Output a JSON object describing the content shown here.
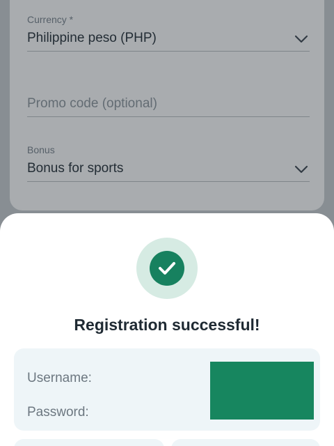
{
  "form": {
    "currency": {
      "label": "Currency *",
      "value": "Philippine peso (PHP)"
    },
    "promo": {
      "placeholder": "Promo code (optional)"
    },
    "bonus": {
      "label": "Bonus",
      "value": "Bonus for sports"
    }
  },
  "dialog": {
    "icon": "check-circle-icon",
    "title": "Registration successful!",
    "credentials": {
      "username_label": "Username:",
      "password_label": "Password:"
    }
  },
  "colors": {
    "accent": "#17815f",
    "accent_light": "#d6ebe3",
    "panel": "#eef5f8",
    "redaction": "#17865f"
  }
}
